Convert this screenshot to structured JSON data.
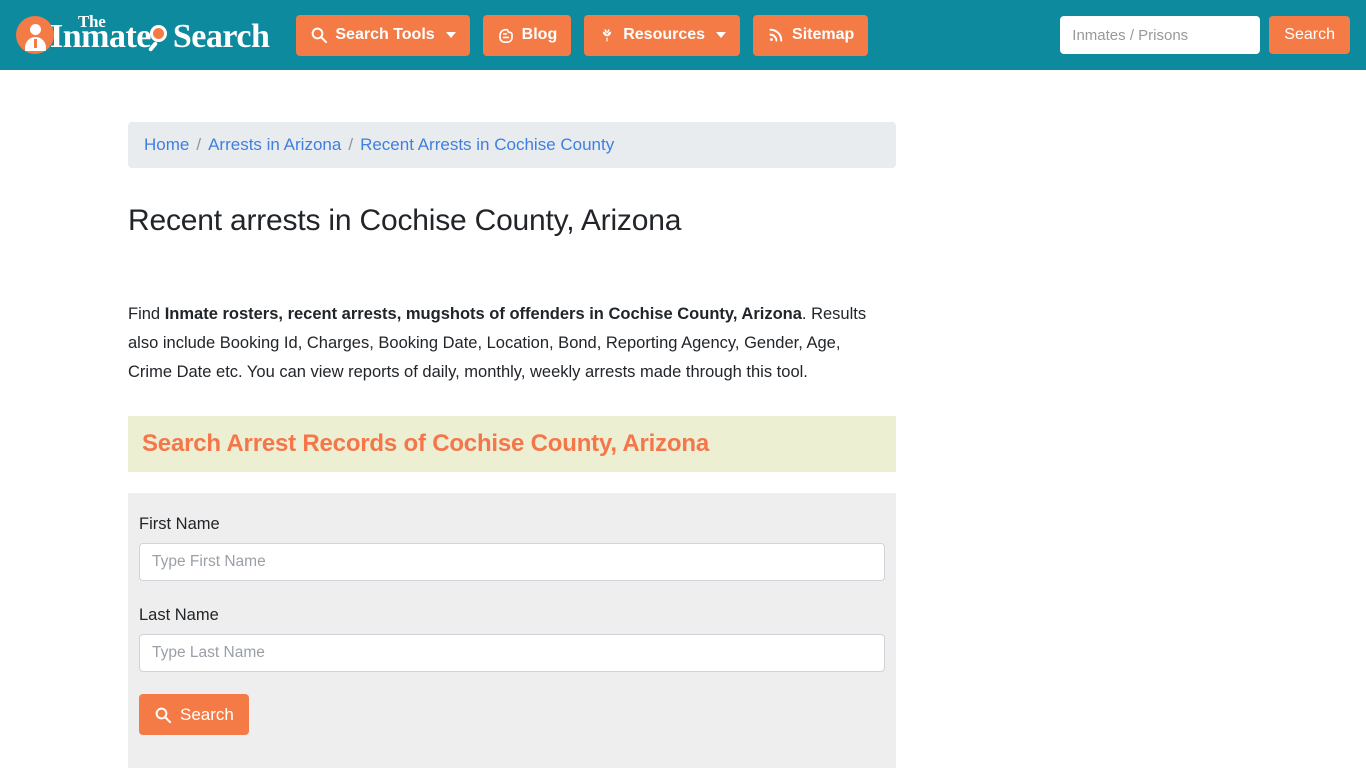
{
  "header": {
    "logo": {
      "the": "The",
      "inmate": "Inmate",
      "search": "Search",
      "badge_icon": "person-in-circle-icon",
      "glass_icon": "magnifier-icon"
    },
    "nav": [
      {
        "label": "Search Tools",
        "icon": "magnifier-icon",
        "has_caret": true
      },
      {
        "label": "Blog",
        "icon": "blogger-icon",
        "has_caret": false
      },
      {
        "label": "Resources",
        "icon": "leaf-icon",
        "has_caret": true
      },
      {
        "label": "Sitemap",
        "icon": "rss-icon",
        "has_caret": false
      }
    ],
    "search": {
      "placeholder": "Inmates / Prisons",
      "value": "",
      "button_label": "Search"
    }
  },
  "breadcrumb": {
    "items": [
      {
        "label": "Home"
      },
      {
        "label": "Arrests in Arizona"
      },
      {
        "label": "Recent Arrests in Cochise County"
      }
    ],
    "separator": "/"
  },
  "main": {
    "page_title": "Recent arrests in Cochise County, Arizona",
    "intro": {
      "lead": "Find ",
      "bold": "Inmate rosters, recent arrests, mugshots of offenders in Cochise County, Arizona",
      "rest": ". Results also include Booking Id, Charges, Booking Date, Location, Bond, Reporting Agency, Gender, Age, Crime Date etc. You can view reports of daily, monthly, weekly arrests made through this tool."
    },
    "section_banner": {
      "title": "Search Arrest Records of Cochise County, Arizona"
    },
    "form": {
      "first_name": {
        "label": "First Name",
        "placeholder": "Type First Name",
        "value": ""
      },
      "last_name": {
        "label": "Last Name",
        "placeholder": "Type Last Name",
        "value": ""
      },
      "submit_label": "Search",
      "submit_icon": "magnifier-icon"
    }
  },
  "colors": {
    "header_teal": "#0e8a9e",
    "accent_orange": "#f47b45",
    "banner_bg": "#edefd3",
    "banner_text": "#f4764a",
    "panel_gray": "#eeeeee",
    "breadcrumb_bg": "#e9ecef",
    "link_blue": "#3f7fe0"
  }
}
